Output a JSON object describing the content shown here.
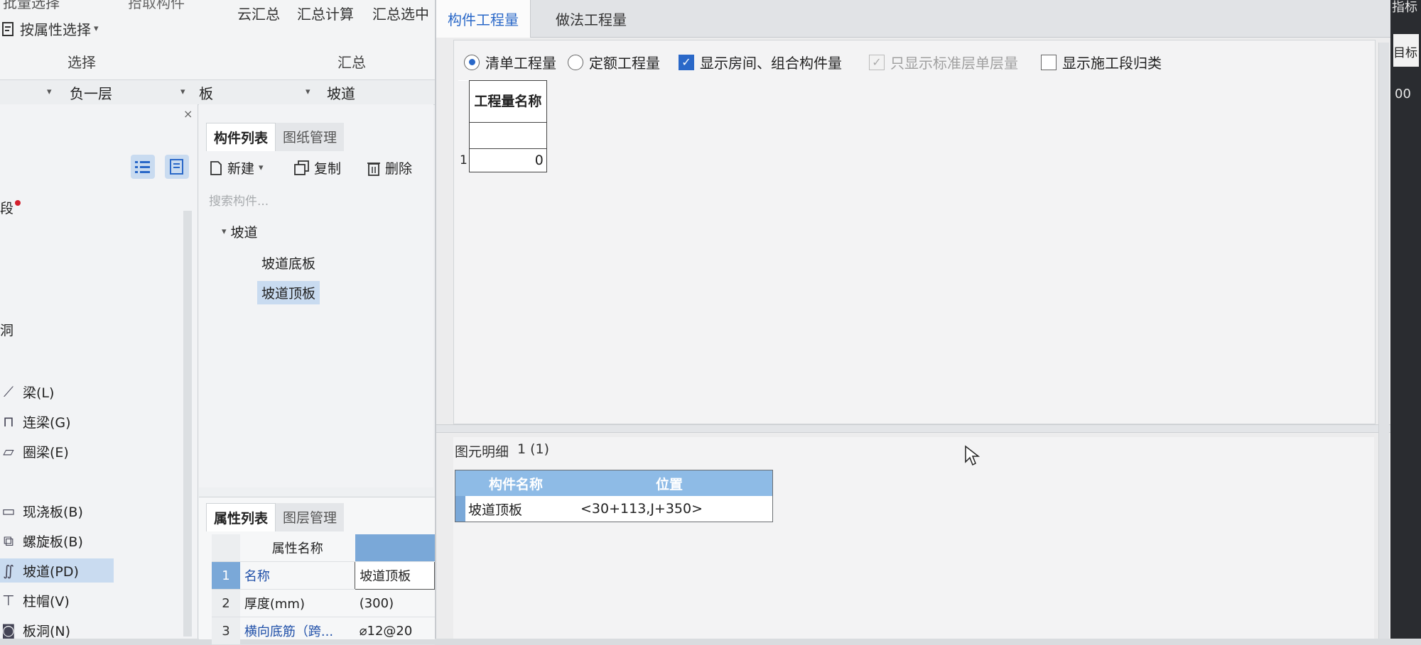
{
  "ribbon": {
    "partial_left": "批量选择",
    "partial_mid": "拾取构件",
    "select_by_attr": "按属性选择",
    "yun_hui_zong": "云汇总",
    "hui_zong_ji_suan": "汇总计算",
    "hui_zong_xuan_zhong": "汇总选中",
    "group_select": "选择",
    "group_summary": "汇总"
  },
  "floor_bar": {
    "floor": "负一层",
    "category": "板",
    "component_type": "坡道"
  },
  "nav": {
    "partial_top": "段",
    "partial_hole": "洞",
    "items": [
      {
        "label": "梁(L)",
        "icon": "beam-icon"
      },
      {
        "label": "连梁(G)",
        "icon": "link-beam-icon"
      },
      {
        "label": "圈梁(E)",
        "icon": "ring-beam-icon"
      },
      {
        "label": "现浇板(B)",
        "icon": "cast-slab-icon"
      },
      {
        "label": "螺旋板(B)",
        "icon": "spiral-slab-icon"
      },
      {
        "label": "坡道(PD)",
        "icon": "ramp-icon"
      },
      {
        "label": "柱帽(V)",
        "icon": "column-cap-icon"
      },
      {
        "label": "板洞(N)",
        "icon": "slab-hole-icon"
      }
    ]
  },
  "component_panel": {
    "tab_list": "构件列表",
    "tab_drawings": "图纸管理",
    "btn_new": "新建",
    "btn_copy": "复制",
    "btn_delete": "删除",
    "search_placeholder": "搜索构件...",
    "tree_root": "坡道",
    "tree_children": [
      "坡道底板",
      "坡道顶板"
    ]
  },
  "property_panel": {
    "tab_props": "属性列表",
    "tab_layers": "图层管理",
    "header_name": "属性名称",
    "rows": [
      {
        "num": "1",
        "name": "名称",
        "value": "坡道顶板"
      },
      {
        "num": "2",
        "name": "厚度(mm)",
        "value": "(300)"
      },
      {
        "num": "3",
        "name": "横向底筋（跨...",
        "value": "⌀12@20"
      }
    ]
  },
  "dialog": {
    "tab_component_qty": "构件工程量",
    "tab_method_qty": "做法工程量",
    "radio_list_qty": "清单工程量",
    "radio_quota_qty": "定额工程量",
    "chk_show_rooms": "显示房间、组合构件量",
    "chk_std_floor": "只显示标准层单层量",
    "chk_construction": "显示施工段归类",
    "qty_table": {
      "header": "工程量名称",
      "row_num": "1",
      "row_value": "0"
    },
    "detail_caption": "图元明细",
    "detail_count": "1 (1)",
    "detail_table": {
      "col_name": "构件名称",
      "col_pos": "位置",
      "row_name": "坡道顶板",
      "row_pos": "<30+113,J+350>"
    }
  },
  "far_right": {
    "label_top": "指标",
    "label_mid": "目标",
    "partial": "00"
  }
}
